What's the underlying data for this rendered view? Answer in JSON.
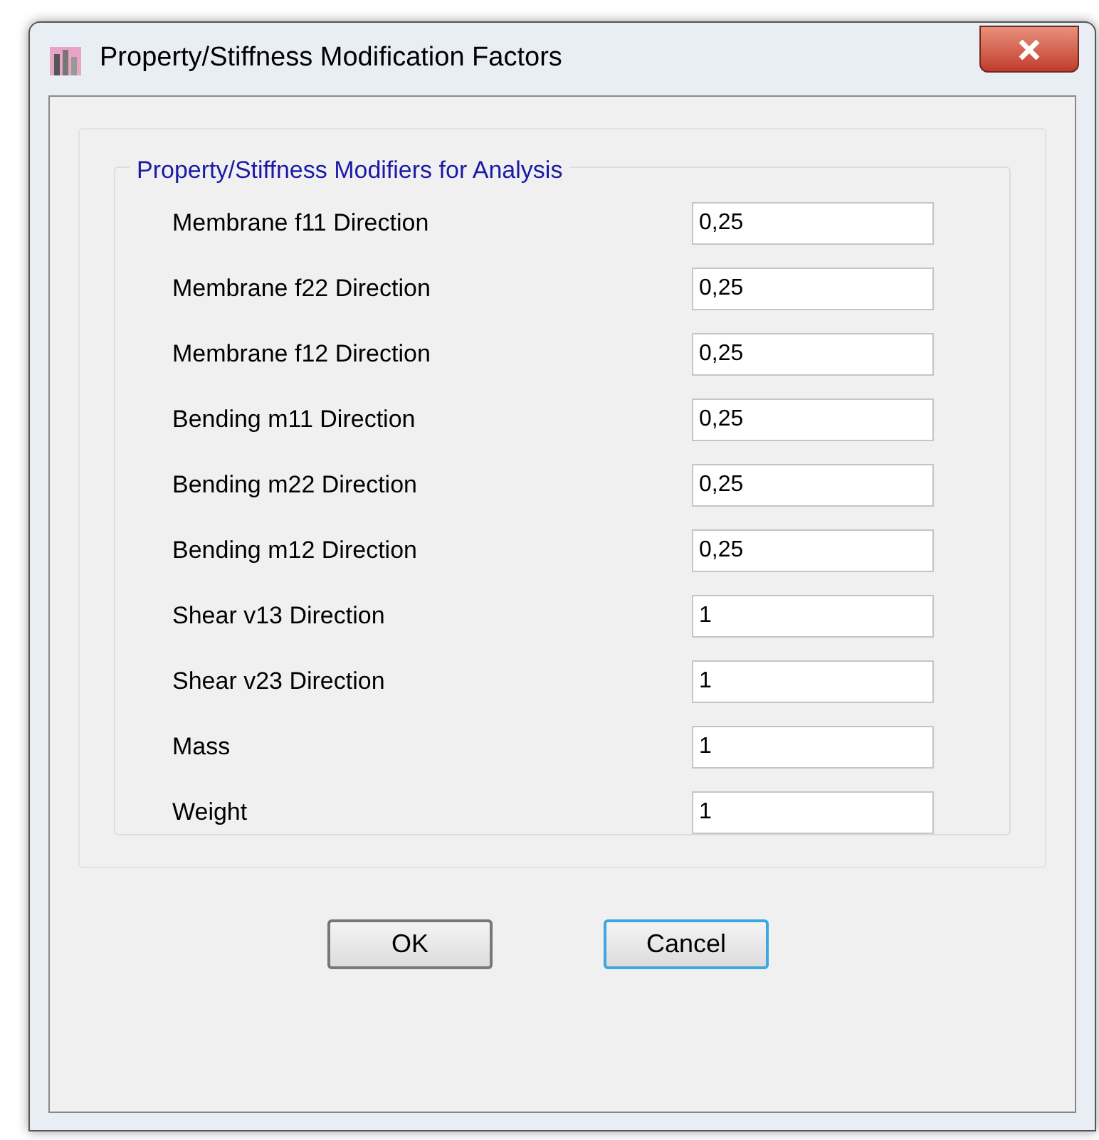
{
  "window": {
    "title": "Property/Stiffness Modification Factors"
  },
  "group": {
    "title": "Property/Stiffness Modifiers for Analysis"
  },
  "fields": [
    {
      "label": "Membrane f11 Direction",
      "value": "0,25"
    },
    {
      "label": "Membrane f22 Direction",
      "value": "0,25"
    },
    {
      "label": "Membrane f12 Direction",
      "value": "0,25"
    },
    {
      "label": "Bending m11 Direction",
      "value": "0,25"
    },
    {
      "label": "Bending m22 Direction",
      "value": "0,25"
    },
    {
      "label": "Bending m12 Direction",
      "value": "0,25"
    },
    {
      "label": "Shear v13 Direction",
      "value": "1"
    },
    {
      "label": "Shear v23 Direction",
      "value": "1"
    },
    {
      "label": "Mass",
      "value": "1"
    },
    {
      "label": "Weight",
      "value": "1"
    }
  ],
  "buttons": [
    {
      "label": "OK",
      "focused": false
    },
    {
      "label": "Cancel",
      "focused": true
    }
  ]
}
